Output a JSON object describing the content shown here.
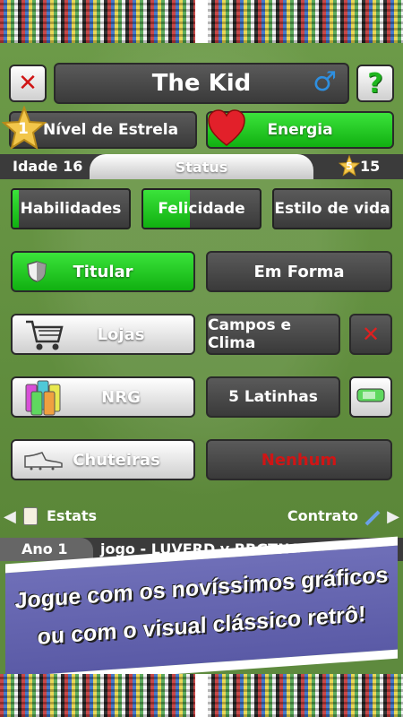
{
  "header": {
    "player_name": "The Kid",
    "gender_symbol": "♂",
    "help_label": "?",
    "close_label": "✕"
  },
  "stars": {
    "level_number": "1",
    "level_label": "Nível de Estrela",
    "energy_label": "Energia"
  },
  "status": {
    "age_label": "Idade 16",
    "tab_label": "Status",
    "star_count": "15",
    "star_mini": "5"
  },
  "bars": {
    "skills": {
      "label": "Habilidades",
      "fill": 0.05
    },
    "happiness": {
      "label": "Felicidade",
      "fill": 0.4
    },
    "lifestyle": {
      "label": "Estilo de vida",
      "fill": 0.0
    }
  },
  "rows": {
    "starter_label": "Titular",
    "fitness_label": "Em Forma",
    "shops_label": "Lojas",
    "fields_label": "Campos e Clima",
    "nrg_label": "NRG",
    "cans_label": "5 Latinhas",
    "boots_label": "Chuteiras",
    "none_label": "Nenhum"
  },
  "nav": {
    "stats_label": "Estats",
    "contract_label": "Contrato"
  },
  "bottom": {
    "year_label": "Ano 1",
    "match_label": "jogo - LUVERD v BRGTNO"
  },
  "promo": {
    "line1": "Jogue com os novíssimos gráficos",
    "line2": "ou com o visual clássico retrô!"
  },
  "colors": {
    "green": "#22c422",
    "dark": "#444444",
    "red": "#cc1111",
    "promo": "#6464b0"
  }
}
